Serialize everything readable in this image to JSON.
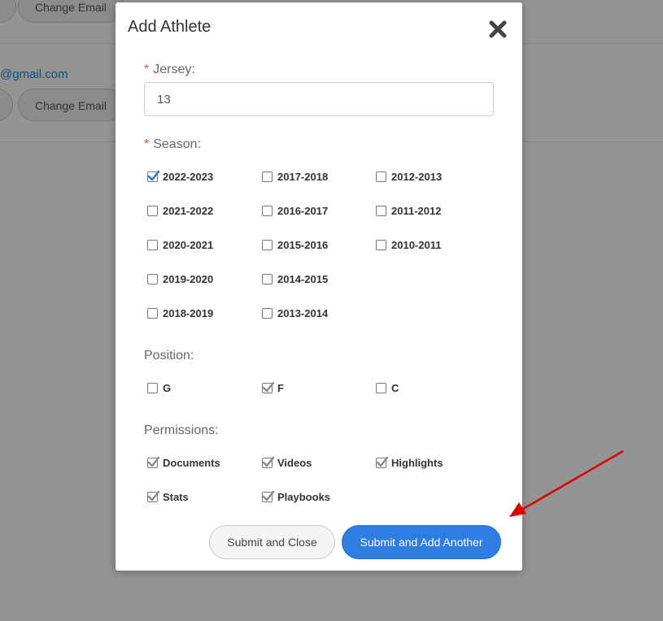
{
  "background": {
    "change_email_label": "Change Email",
    "email_fragment": "@gmail.com"
  },
  "modal": {
    "title": "Add Athlete",
    "close_icon": "close-icon",
    "jersey": {
      "label": "Jersey:",
      "value": "13",
      "required": true
    },
    "season": {
      "label": "Season:",
      "required": true,
      "options": [
        {
          "label": "2022-2023",
          "checked": true
        },
        {
          "label": "2021-2022",
          "checked": false
        },
        {
          "label": "2020-2021",
          "checked": false
        },
        {
          "label": "2019-2020",
          "checked": false
        },
        {
          "label": "2018-2019",
          "checked": false
        },
        {
          "label": "2017-2018",
          "checked": false
        },
        {
          "label": "2016-2017",
          "checked": false
        },
        {
          "label": "2015-2016",
          "checked": false
        },
        {
          "label": "2014-2015",
          "checked": false
        },
        {
          "label": "2013-2014",
          "checked": false
        },
        {
          "label": "2012-2013",
          "checked": false
        },
        {
          "label": "2011-2012",
          "checked": false
        },
        {
          "label": "2010-2011",
          "checked": false
        }
      ]
    },
    "position": {
      "label": "Position:",
      "options": [
        {
          "label": "G",
          "checked": false
        },
        {
          "label": "F",
          "checked": true
        },
        {
          "label": "C",
          "checked": false
        }
      ]
    },
    "permissions": {
      "label": "Permissions:",
      "options": [
        {
          "label": "Documents",
          "checked": true
        },
        {
          "label": "Videos",
          "checked": true
        },
        {
          "label": "Highlights",
          "checked": true
        },
        {
          "label": "Stats",
          "checked": true
        },
        {
          "label": "Playbooks",
          "checked": true
        }
      ]
    },
    "buttons": {
      "submit_close": "Submit and Close",
      "submit_add_another": "Submit and Add Another"
    }
  },
  "colors": {
    "primary": "#2d7de2",
    "required": "#d9534f",
    "checked_blue": "#1a73e8",
    "checked_gray": "#8a8a8a",
    "arrow": "#e00000"
  }
}
